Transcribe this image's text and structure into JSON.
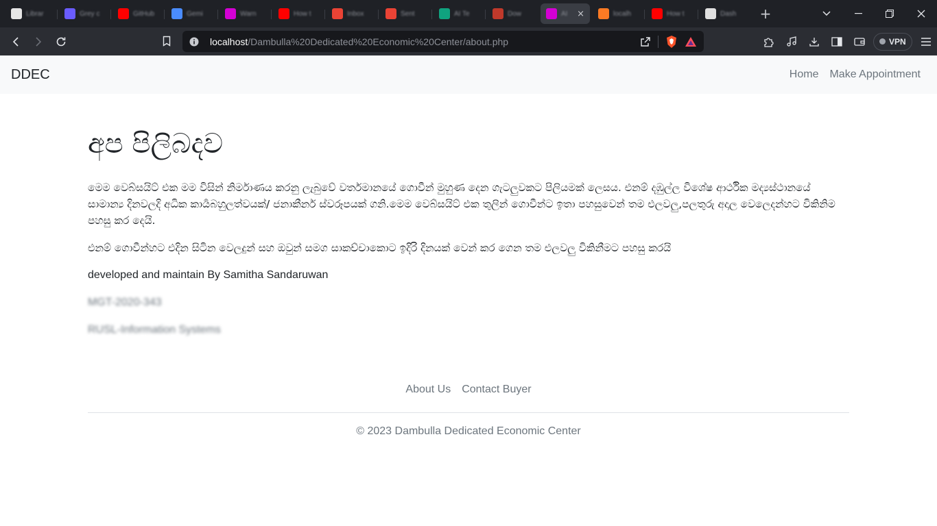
{
  "browser": {
    "tabs": [
      {
        "title": "Librar",
        "icon": "github-icon",
        "color": "#e6e6e6"
      },
      {
        "title": "Grey c",
        "icon": "globe-icon",
        "color": "#6a5cff"
      },
      {
        "title": "GitHub",
        "icon": "youtube-icon",
        "color": "#ff0000"
      },
      {
        "title": "Gemi",
        "icon": "gemini-icon",
        "color": "#4a8cff"
      },
      {
        "title": "Warn",
        "icon": "app-icon",
        "color": "#d400d4"
      },
      {
        "title": "How t",
        "icon": "youtube-icon",
        "color": "#ff0000"
      },
      {
        "title": "Inbox",
        "icon": "gmail-icon",
        "color": "#ea4335"
      },
      {
        "title": "Sent",
        "icon": "gmail-icon",
        "color": "#ea4335"
      },
      {
        "title": "AI Te",
        "icon": "ai-icon",
        "color": "#10a37f"
      },
      {
        "title": "Dow",
        "icon": "download-site-icon",
        "color": "#c0392b"
      },
      {
        "title": "AI",
        "icon": "app-icon",
        "color": "#d400d4",
        "active": true
      },
      {
        "title": "localh",
        "icon": "xampp-icon",
        "color": "#fb7a24"
      },
      {
        "title": "How t",
        "icon": "youtube-icon",
        "color": "#ff0000"
      },
      {
        "title": "Dash",
        "icon": "dashboard-icon",
        "color": "#e0e0e0"
      }
    ],
    "url_host": "localhost",
    "url_path": "/Dambulla%20Dedicated%20Economic%20Center/about.php",
    "vpn_label": "VPN",
    "accent": "#fb542b"
  },
  "site": {
    "brand": "DDEC",
    "nav": {
      "home": "Home",
      "appointment": "Make Appointment"
    }
  },
  "about": {
    "title": "අප පිලිබදව",
    "para1": "මෙම වෙබ්සයිට් එක මම විසින් නිර්මාණය කරනු ලැබුවේ වර්තමානයේ ගොවීන් මුහුණ දෙන ගැටලුවකට පිලියමක් ලෙසය. එනම් දඹුල්ල විශේෂ ආර්ථික මද්‍යස්ථානයේ සාමාන්‍ය දිනවලදි අධික කාර්‍යබහුලත්වයක්/ ජනාකීර්න ස්වරූපයක් ගනි.මෙම වෙබ්සයිට් එක තුලින් ගොවීන්ට ඉතා පහසුවෙන් තම එලවලු,පලතුරු අදාල වෙලෙදන්හට විකිනිම පහසු කර දෙයි.",
    "para2": "එනම් ගොවීන්හට එදින සිටින වෙලදුන් සහ ඔවුන් සමග සාකච්චාකොට ඉදිරි දිනයක් වෙන් කර ගෙන තම එලවලු විකිනීමට පහසු කරයි",
    "developer": "developed and maintain By Samitha Sandaruwan",
    "student_id": "MGT-2020-343",
    "department": "RUSL-Information Systems"
  },
  "footer": {
    "about_us": "About Us",
    "contact_buyer": "Contact Buyer",
    "copyright": "© 2023 Dambulla Dedicated Economic Center"
  }
}
